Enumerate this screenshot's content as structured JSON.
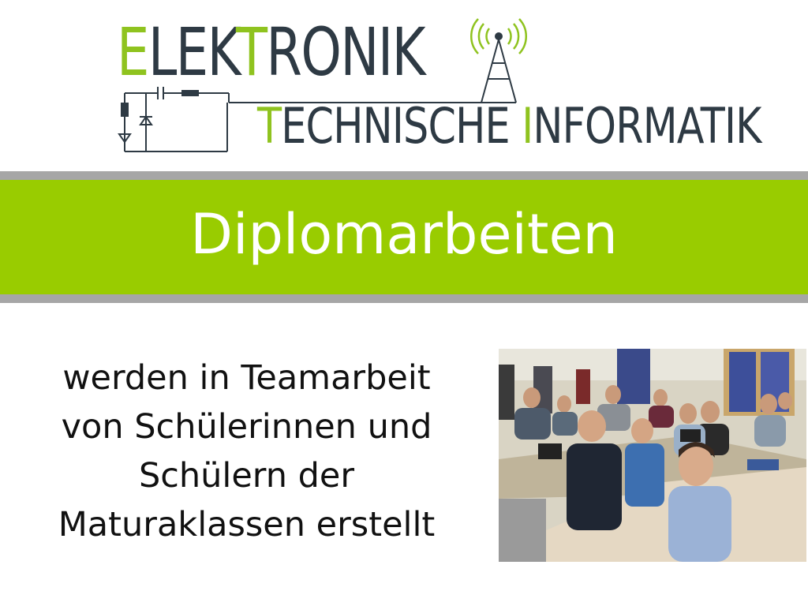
{
  "logo": {
    "title_first": "E",
    "title_mid": "LEK",
    "title_t": "T",
    "title_rest": "RONIK",
    "sub_first": "T",
    "sub_mid": "ECHNISCHE ",
    "sub_i": "I",
    "sub_rest": "NFORMATIK",
    "accent_color": "#8fc31f",
    "text_color": "#2e3a44"
  },
  "banner": {
    "title": "Diplomarbeiten",
    "color": "#99cc00"
  },
  "body": {
    "lines": [
      "werden in Teamarbeit",
      "von Schülerinnen und",
      "Schülern der",
      "Maturaklassen erstellt"
    ]
  },
  "photo": {
    "subject": "students-in-classroom-photo"
  }
}
